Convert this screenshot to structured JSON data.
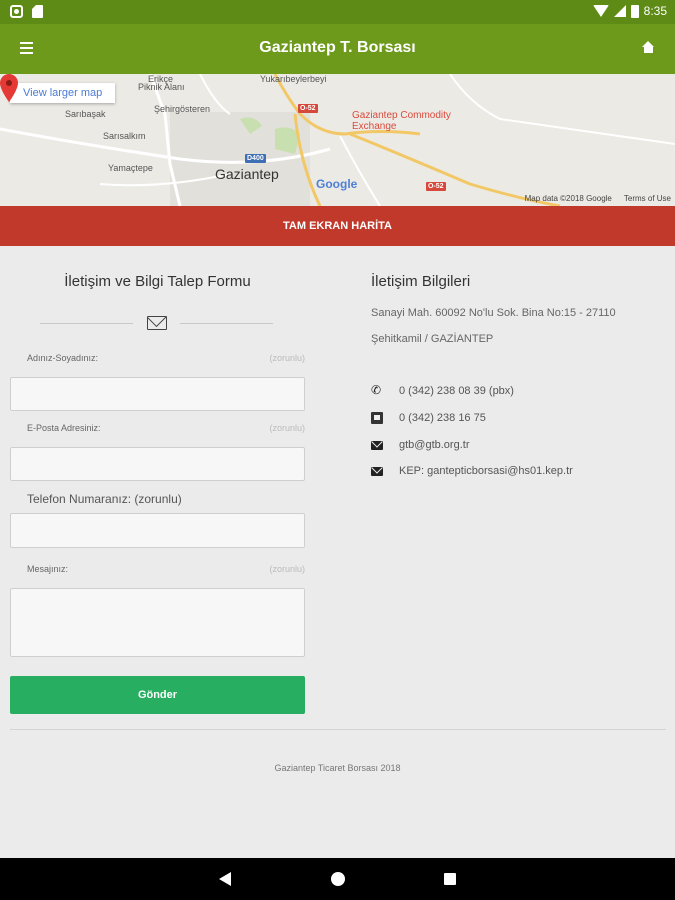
{
  "status_bar": {
    "time": "8:35"
  },
  "app_bar": {
    "title": "Gaziantep T. Borsası"
  },
  "map": {
    "larger_map_label": "View larger map",
    "city_label": "Gaziantep",
    "pin_label_line1": "Gaziantep Commodity",
    "pin_label_line2": "Exchange",
    "place_labels": {
      "erikce": "Erikçe",
      "piknik": "Piknik Alanı",
      "yukaribeylerbeyi": "Yukarıbeylerbeyi",
      "sehirgosteren": "Şehirgösteren",
      "saribasak": "Sarıbaşak",
      "sarisalkim": "Sarısalkım",
      "yamactepe": "Yamaçtepe"
    },
    "road_badges": {
      "d400": "D400",
      "o52_top": "O-52",
      "o52_bottom": "O-52"
    },
    "google_label": "Google",
    "attribution": "Map data ©2018 Google",
    "terms": "Terms of Use",
    "colors": {
      "pin": "#e53935",
      "park": "#c8e0b0",
      "highway": "#f2c867",
      "road_badge_red": "#d6483b",
      "road_badge_blue": "#3f6fb5"
    }
  },
  "fullscreen_button": {
    "label": "TAM EKRAN HARİTA"
  },
  "form": {
    "title": "İletişim ve Bilgi Talep Formu",
    "name_label": "Adınız-Soyadınız:",
    "name_required": "(zorunlu)",
    "email_label": "E-Posta Adresiniz:",
    "email_required": "(zorunlu)",
    "phone_label": "Telefon Numaranız: (zorunlu)",
    "message_label": "Mesajınız:",
    "message_required": "(zorunlu)",
    "submit_label": "Gönder"
  },
  "contact": {
    "title": "İletişim Bilgileri",
    "address_line1": "Sanayi Mah. 60092 No'lu Sok. Bina No:15 - 27110",
    "address_line2": "Şehitkamil / GAZİANTEP",
    "phone": "0 (342) 238 08 39 (pbx)",
    "fax": "0 (342) 238 16 75",
    "email": "gtb@gtb.org.tr",
    "kep": "KEP: gantepticborsasi@hs01.kep.tr"
  },
  "footer": {
    "text": "Gaziantep Ticaret Borsası 2018"
  },
  "theme": {
    "statusbar": "#5e8a16",
    "appbar": "#6e9a1c",
    "danger": "#c0392b",
    "success": "#27ae60"
  }
}
